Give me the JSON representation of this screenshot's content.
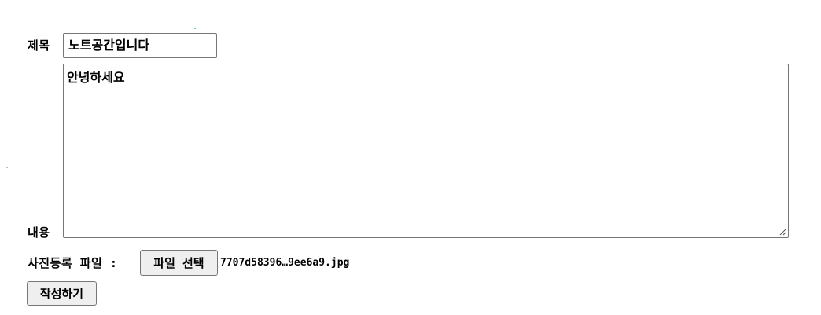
{
  "form": {
    "title_label": "제목",
    "title_value": "노트공간입니다",
    "content_label": "내용",
    "content_value": "안녕하세요",
    "file_label": "사진등록 파일 :",
    "file_button_label": "파일 선택",
    "file_name": "7707d58396…9ee6a9.jpg",
    "submit_label": "작성하기"
  },
  "icons": {
    "resize_grip": "resize-grip-icon"
  }
}
